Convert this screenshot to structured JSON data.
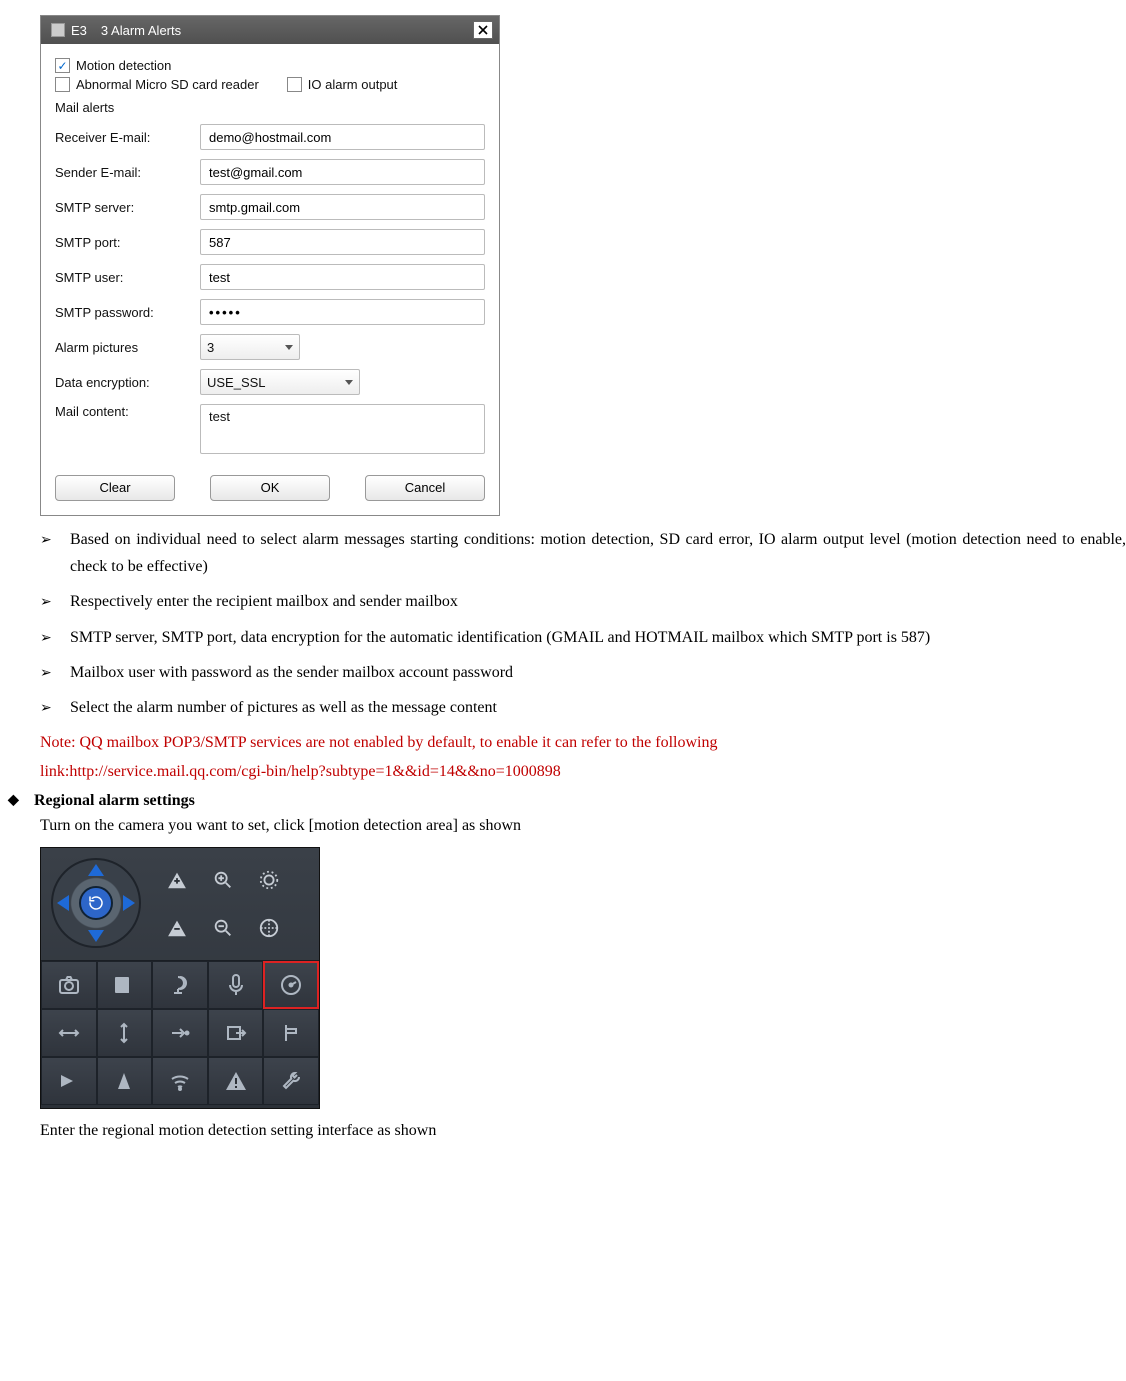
{
  "dialog": {
    "title": "E3     3 Alarm Alerts",
    "checkboxes": {
      "motion": {
        "label": "Motion detection",
        "checked": true
      },
      "sd": {
        "label": "Abnormal Micro SD card reader",
        "checked": false
      },
      "io": {
        "label": "IO alarm output",
        "checked": false
      }
    },
    "group_title": "Mail alerts",
    "fields": {
      "receiver": {
        "label": "Receiver E-mail:",
        "value": "demo@hostmail.com"
      },
      "sender": {
        "label": "Sender E-mail:",
        "value": "test@gmail.com"
      },
      "server": {
        "label": "SMTP server:",
        "value": "smtp.gmail.com"
      },
      "port": {
        "label": "SMTP port:",
        "value": "587"
      },
      "user": {
        "label": "SMTP user:",
        "value": "test"
      },
      "password": {
        "label": "SMTP password:",
        "value": "•••••"
      },
      "pictures": {
        "label": "Alarm pictures",
        "value": "3"
      },
      "encrypt": {
        "label": "Data encryption:",
        "value": "USE_SSL"
      },
      "content": {
        "label": "Mail content:",
        "value": "test"
      }
    },
    "buttons": {
      "clear": "Clear",
      "ok": "OK",
      "cancel": "Cancel"
    }
  },
  "bullets": [
    "Based on individual need to select alarm messages starting conditions: motion detection, SD card error, IO alarm output level (motion detection need to enable, check to be effective)",
    "Respectively enter the recipient mailbox and sender mailbox",
    "SMTP server, SMTP port, data encryption for the automatic identification (GMAIL and HOTMAIL mailbox which SMTP port is 587)",
    "Mailbox user with password as the sender mailbox account password",
    "Select the alarm number of pictures as well as the message content"
  ],
  "note_line1": "Note: QQ mailbox POP3/SMTP services are not enabled by default, to enable it can refer to the following",
  "note_line2": "link:http://service.mail.qq.com/cgi-bin/help?subtype=1&&id=14&&no=1000898",
  "section_heading": "Regional alarm settings",
  "section_intro": "Turn on the camera you want to set, click [motion detection area] as shown",
  "section_outro": "Enter the regional motion detection setting interface as shown"
}
